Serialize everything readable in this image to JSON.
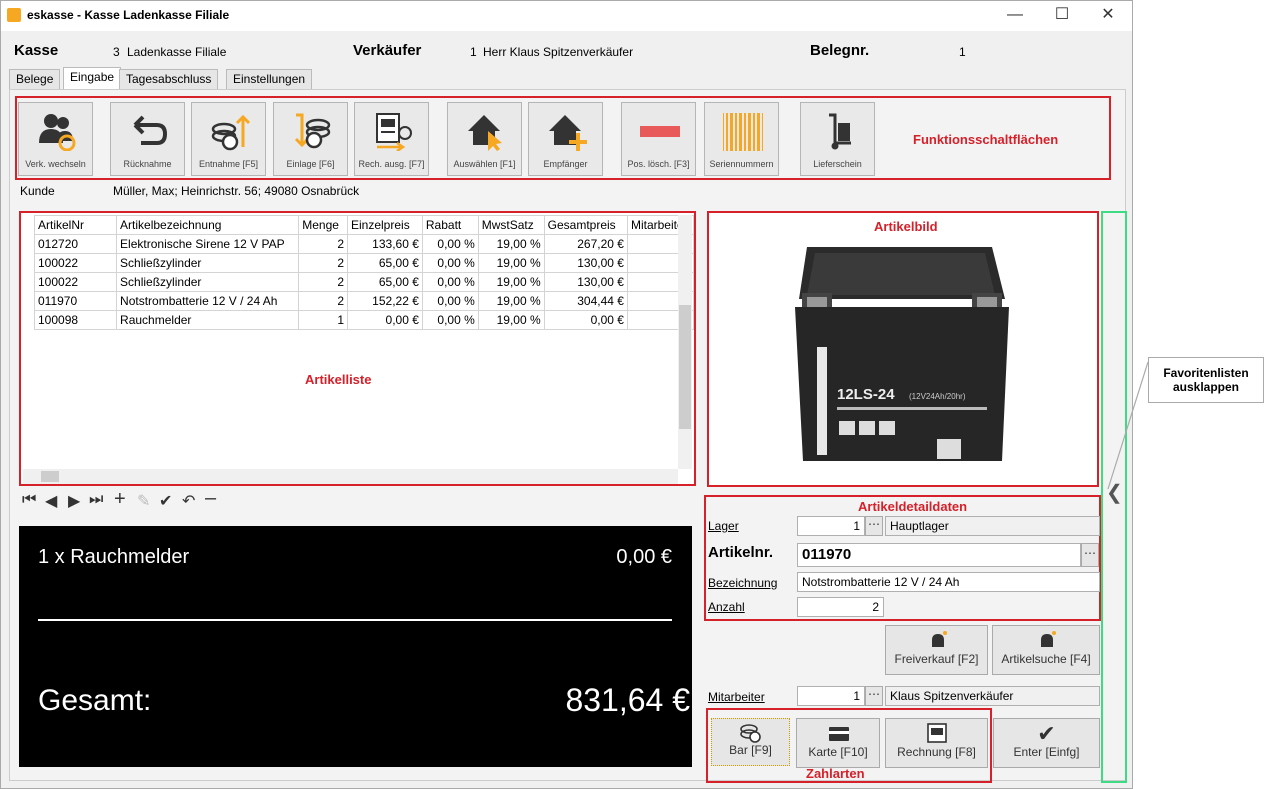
{
  "window": {
    "title": "eskasse - Kasse Ladenkasse Filiale"
  },
  "header": {
    "kasse_label": "Kasse",
    "kasse_nr": "3",
    "kasse_name": "Ladenkasse Filiale",
    "verkaeufer_label": "Verkäufer",
    "verkaeufer_nr": "1",
    "verkaeufer_name": "Herr Klaus Spitzenverkäufer",
    "beleg_label": "Belegnr.",
    "beleg_nr": "1"
  },
  "tabs": [
    "Belege",
    "Eingabe",
    "Tagesabschluss",
    "Einstellungen"
  ],
  "toolbar": {
    "buttons": [
      "Verk. wechseln",
      "Rücknahme",
      "Entnahme [F5]",
      "Einlage [F6]",
      "Rech. ausg. [F7]",
      "Auswählen [F1]",
      "Empfänger",
      "Pos. lösch. [F3]",
      "Seriennummern",
      "Lieferschein"
    ],
    "annotation": "Funktionsschaltflächen"
  },
  "customer": {
    "label": "Kunde",
    "value": "Müller, Max; Heinrichstr. 56; 49080 Osnabrück"
  },
  "articles": {
    "columns": [
      "ArtikelNr",
      "Artikelbezeichnung",
      "Menge",
      "Einzelpreis",
      "Rabatt",
      "MwstSatz",
      "Gesamtpreis",
      "Mitarbeiter"
    ],
    "rows": [
      [
        "012720",
        "Elektronische Sirene 12 V PAP",
        "2",
        "133,60 €",
        "0,00 %",
        "19,00 %",
        "267,20 €",
        ""
      ],
      [
        "100022",
        "Schließzylinder",
        "2",
        "65,00 €",
        "0,00 %",
        "19,00 %",
        "130,00 €",
        ""
      ],
      [
        "100022",
        "Schließzylinder",
        "2",
        "65,00 €",
        "0,00 %",
        "19,00 %",
        "130,00 €",
        ""
      ],
      [
        "011970",
        "Notstrombatterie 12 V / 24 Ah",
        "2",
        "152,22 €",
        "0,00 %",
        "19,00 %",
        "304,44 €",
        ""
      ],
      [
        "100098",
        "Rauchmelder",
        "1",
        "0,00 €",
        "0,00 %",
        "19,00 %",
        "0,00 €",
        ""
      ]
    ],
    "annotation": "Artikelliste"
  },
  "display": {
    "line": "1 x Rauchmelder",
    "line_price": "0,00 €",
    "total_label": "Gesamt:",
    "total": "831,64 €"
  },
  "image": {
    "annotation": "Artikelbild",
    "battery_model": "12LS-24",
    "battery_spec": "(12V24Ah/20hr)"
  },
  "details": {
    "annotation": "Artikeldetaildaten",
    "lager_label": "Lager",
    "lager_nr": "1",
    "lager_name": "Hauptlager",
    "artnr_label": "Artikelnr.",
    "artnr": "011970",
    "bez_label": "Bezeichnung",
    "bez": "Notstrombatterie 12 V / 24 Ah",
    "anzahl_label": "Anzahl",
    "anzahl": "2"
  },
  "actions": {
    "freiverkauf": "Freiverkauf [F2]",
    "artikelsuche": "Artikelsuche [F4]"
  },
  "mitarbeiter": {
    "label": "Mitarbeiter",
    "nr": "1",
    "name": "Klaus Spitzenverkäufer"
  },
  "payment": {
    "bar": "Bar [F9]",
    "karte": "Karte [F10]",
    "rechnung": "Rechnung [F8]",
    "enter": "Enter [Einfg]",
    "annotation": "Zahlarten"
  },
  "callout": {
    "line1": "Favoritenlisten",
    "line2": "ausklappen"
  },
  "colors": {
    "annotation_red": "#d6202a",
    "favorites_green": "#3ddc84",
    "toolbar_orange": "#f7a823"
  }
}
